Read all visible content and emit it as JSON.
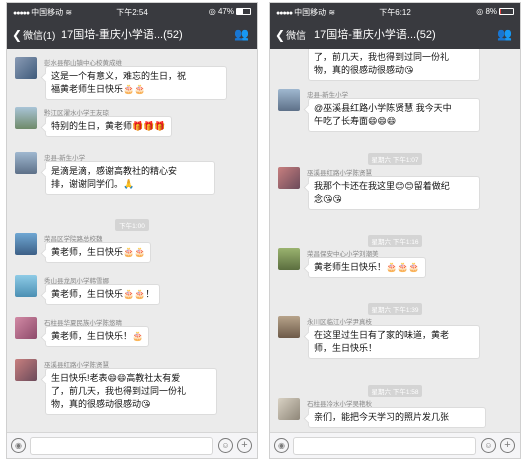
{
  "colors": {
    "chat_bg": "#ebebeb",
    "header_bg": "#393a3f",
    "bubble_bg": "#ffffff"
  },
  "left": {
    "status": {
      "carrier": "中国移动",
      "time": "下午2:54",
      "battery": "47%",
      "battery_level": 0.47
    },
    "nav": {
      "back": "微信(1)",
      "title": "17国培-重庆小学语...(52)"
    },
    "messages": [
      {
        "sender": "彭水县郁山镇中心校黄成维",
        "lines": [
          "这是一个有意义，难忘的生日，祝",
          "福黄老师生日快乐🎂🎂"
        ]
      },
      {
        "sender": "黔江区濯水小学王友琼",
        "lines": [
          "特别的生日，黄老师🎁🎁🎁"
        ]
      },
      {
        "sender": "忠县-新生小学",
        "lines": [
          "是滴是滴，感谢高教社的精心安",
          "排，谢谢同学们。🙏"
        ]
      },
      {
        "timestamp": "下午1:00"
      },
      {
        "sender": "荣昌区学院路总校魏",
        "lines": [
          "黄老师，生日快乐🎂🎂"
        ]
      },
      {
        "sender": "秀山县龙凤小学韩雪娜",
        "lines": [
          "黄老师，生日快乐🎂🎂！"
        ]
      },
      {
        "sender": "石柱县华夏民族小学陈悠晴",
        "lines": [
          "黄老师，生日快乐！🎂"
        ]
      },
      {
        "sender": "巫溪县红路小学陈贤慧",
        "lines": [
          "生日快乐!老表😄😄高教社太有爱",
          "了，前几天，我也得到过同一份礼",
          "物，真的很感动很感动😘"
        ]
      }
    ]
  },
  "right": {
    "status": {
      "carrier": "中国移动",
      "time": "下午6:12",
      "battery": "8%",
      "battery_level": 0.08
    },
    "nav": {
      "back": "微信",
      "title": "17国培-重庆小学语...(52)"
    },
    "top_continuation": [
      "了，前几天，我也得到过同一份礼",
      "物，真的很感动很感动😘"
    ],
    "messages": [
      {
        "sender": "忠县-新生小学",
        "lines": [
          "@巫溪县红路小学陈贤慧 我今天中",
          "午吃了长寿面😄😄😄"
        ]
      },
      {
        "timestamp": "星期六 下午1:07"
      },
      {
        "sender": "巫溪县红路小学陈贤慧",
        "lines": [
          "我那个卡还在我这里😊😊留着做纪",
          "念😘😘"
        ]
      },
      {
        "timestamp": "星期六 下午1:16"
      },
      {
        "sender": "荣昌保安中心小学刘潮美",
        "lines": [
          "黄老师生日快乐！🎂🎂🎂"
        ]
      },
      {
        "timestamp": "星期六 下午1:39"
      },
      {
        "sender": "永川区临江小学尹真枝",
        "lines": [
          "在这里过生日有了家的味道，黄老",
          "师，生日快乐！"
        ]
      },
      {
        "timestamp": "星期六 下午1:58"
      },
      {
        "sender": "石柱县冷水小学吴艳秋",
        "lines": [
          "亲们，能把今天学习的照片发几张"
        ]
      }
    ]
  }
}
